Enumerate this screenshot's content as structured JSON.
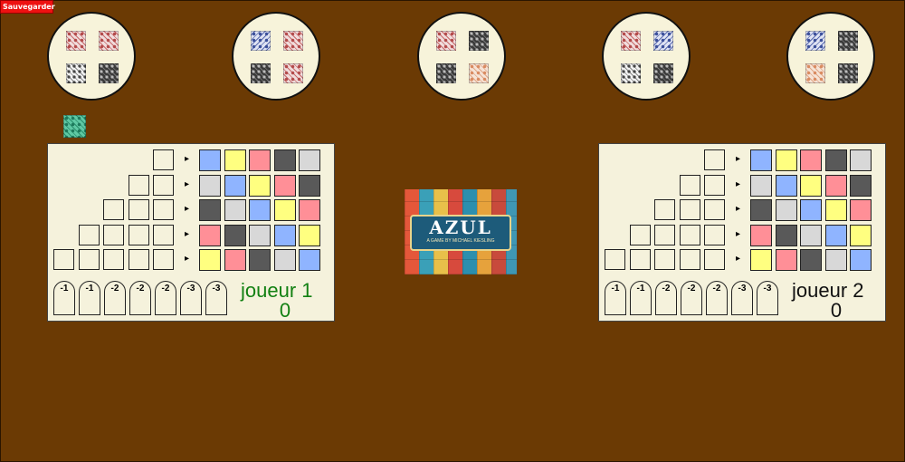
{
  "toolbar": {
    "save_label": "Sauvegarder"
  },
  "factories": [
    {
      "tiles": [
        "pink",
        "pink",
        "white",
        "black"
      ]
    },
    {
      "tiles": [
        "blue",
        "pink",
        "black",
        "pink"
      ]
    },
    {
      "tiles": [
        "pink",
        "black",
        "black",
        "orange"
      ]
    },
    {
      "tiles": [
        "pink",
        "blue",
        "white",
        "black"
      ]
    },
    {
      "tiles": [
        "blue",
        "black",
        "orange",
        "black"
      ]
    }
  ],
  "center": {
    "first_player_token": "first-player-tile"
  },
  "logo": {
    "title": "AZUL",
    "subtitle": "A GAME BY MICHAEL KIESLING"
  },
  "players": [
    {
      "name": "joueur 1",
      "score": "0",
      "name_color": "#128012",
      "pattern_lines": [
        1,
        2,
        3,
        4,
        5
      ],
      "wall": [
        [
          "blue",
          "yellow",
          "red",
          "black",
          "white"
        ],
        [
          "white",
          "blue",
          "yellow",
          "red",
          "black"
        ],
        [
          "black",
          "white",
          "blue",
          "yellow",
          "red"
        ],
        [
          "red",
          "black",
          "white",
          "blue",
          "yellow"
        ],
        [
          "yellow",
          "red",
          "black",
          "white",
          "blue"
        ]
      ],
      "floor": [
        "-1",
        "-1",
        "-2",
        "-2",
        "-2",
        "-3",
        "-3"
      ]
    },
    {
      "name": "joueur 2",
      "score": "0",
      "name_color": "#111111",
      "pattern_lines": [
        1,
        2,
        3,
        4,
        5
      ],
      "wall": [
        [
          "blue",
          "yellow",
          "red",
          "black",
          "white"
        ],
        [
          "white",
          "blue",
          "yellow",
          "red",
          "black"
        ],
        [
          "black",
          "white",
          "blue",
          "yellow",
          "red"
        ],
        [
          "red",
          "black",
          "white",
          "blue",
          "yellow"
        ],
        [
          "yellow",
          "red",
          "black",
          "white",
          "blue"
        ]
      ],
      "floor": [
        "-1",
        "-1",
        "-2",
        "-2",
        "-2",
        "-3",
        "-3"
      ]
    }
  ]
}
